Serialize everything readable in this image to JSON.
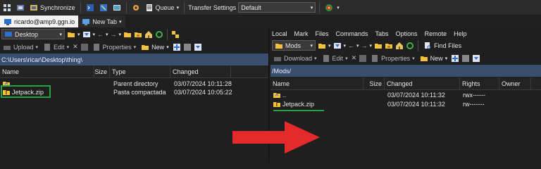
{
  "toolbar": {
    "synchronize": "Synchronize",
    "queue": "Queue",
    "transfer_settings_label": "Transfer Settings",
    "transfer_settings_value": "Default"
  },
  "tabs": [
    {
      "label": "ricardo@amp9.ggn.io"
    },
    {
      "label": "New Tab"
    }
  ],
  "left": {
    "location": "Desktop",
    "actions": {
      "upload": "Upload",
      "edit": "Edit",
      "properties": "Properties",
      "new": "New"
    },
    "path": "C:\\Users\\ricar\\Desktop\\thing\\",
    "columns": {
      "name": "Name",
      "size": "Size",
      "type": "Type",
      "changed": "Changed"
    },
    "rows": [
      {
        "name": "..",
        "size": "",
        "type": "Parent directory",
        "changed": "03/07/2024 10:11:28"
      },
      {
        "name": "Jetpack.zip",
        "size": "",
        "type": "Pasta compactada",
        "changed": "03/07/2024 10:05:22"
      }
    ]
  },
  "right": {
    "menu": [
      "Local",
      "Mark",
      "Files",
      "Commands",
      "Tabs",
      "Options",
      "Remote",
      "Help"
    ],
    "location": "Mods",
    "find_files": "Find Files",
    "actions": {
      "download": "Download",
      "edit": "Edit",
      "properties": "Properties",
      "new": "New"
    },
    "path": "/Mods/",
    "columns": {
      "name": "Name",
      "size": "Size",
      "changed": "Changed",
      "rights": "Rights",
      "owner": "Owner"
    },
    "rows": [
      {
        "name": "..",
        "size": "",
        "changed": "03/07/2024 10:11:32",
        "rights": "rwx------",
        "owner": ""
      },
      {
        "name": "Jetpack.zip",
        "size": "",
        "changed": "03/07/2024 10:11:32",
        "rights": "rw-------",
        "owner": ""
      }
    ]
  },
  "colors": {
    "highlight_green": "#25a244",
    "arrow_red": "#e32b2b",
    "path_bar": "#3a4f70",
    "folder_yellow": "#f3c13a"
  }
}
